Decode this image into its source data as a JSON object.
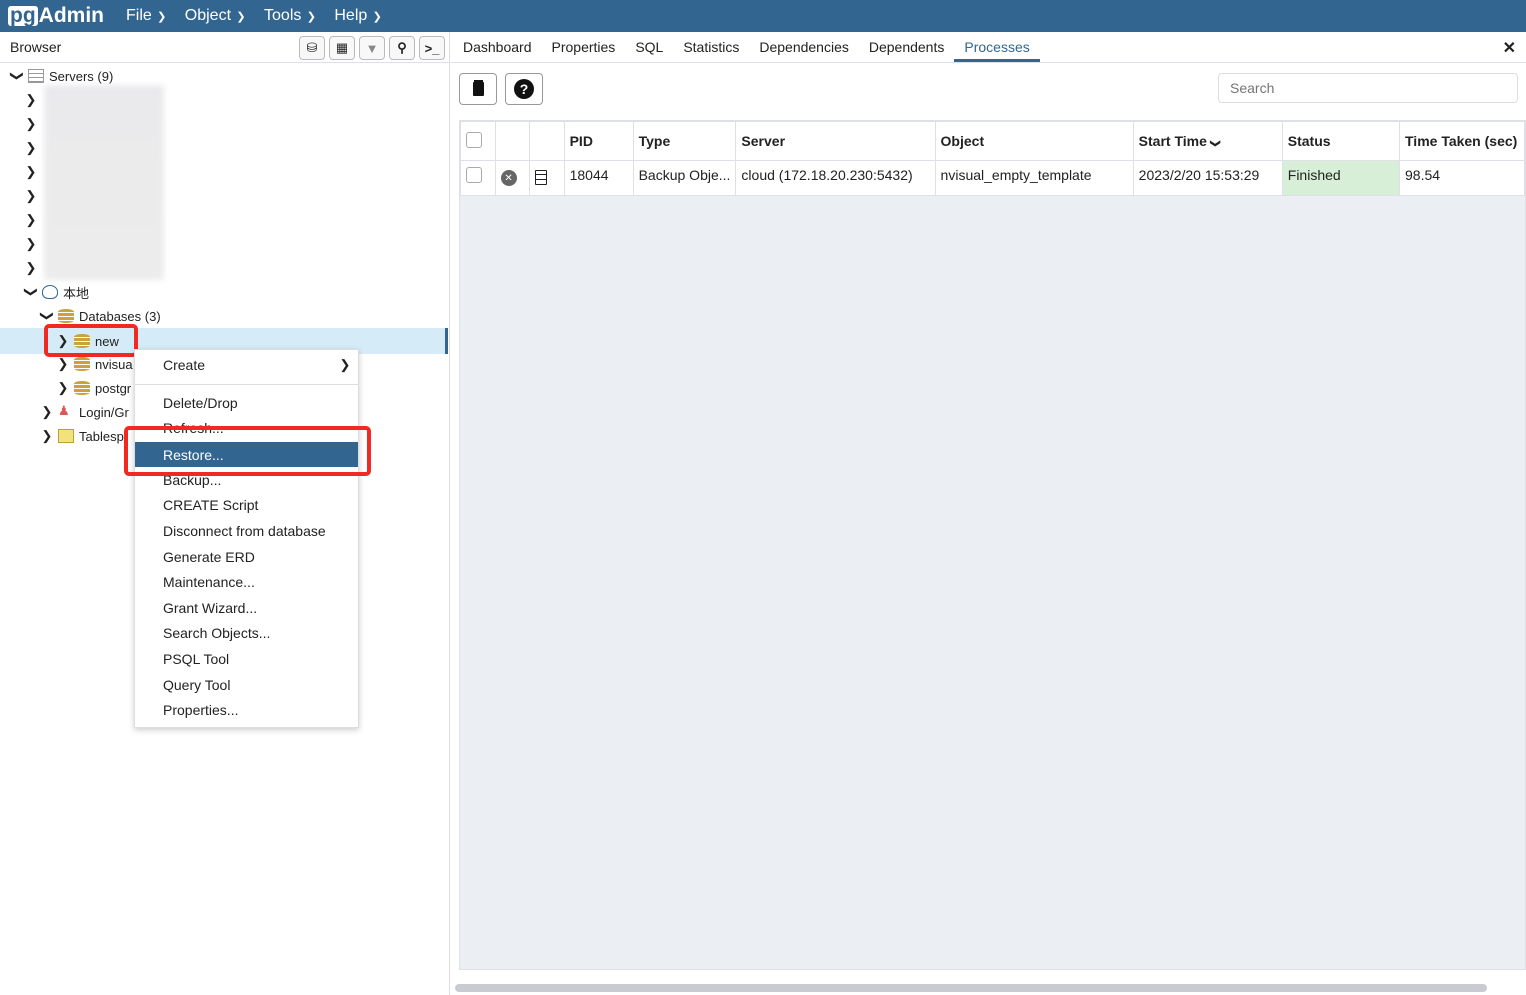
{
  "app": {
    "logo_pg": "pg",
    "logo_admin": "Admin",
    "menu": [
      "File",
      "Object",
      "Tools",
      "Help"
    ]
  },
  "browser": {
    "title": "Browser",
    "tree": {
      "servers": "Servers (9)",
      "local": "本地",
      "databases": "Databases (3)",
      "db_new": "new",
      "db_nvisual": "nvisua",
      "db_postgres": "postgr",
      "login": "Login/Gr",
      "tablespaces": "Tablesp"
    }
  },
  "context_menu": {
    "items": [
      "Create",
      "Delete/Drop",
      "Refresh...",
      "Restore...",
      "Backup...",
      "CREATE Script",
      "Disconnect from database",
      "Generate ERD",
      "Maintenance...",
      "Grant Wizard...",
      "Search Objects...",
      "PSQL Tool",
      "Query Tool",
      "Properties..."
    ],
    "active": "Restore..."
  },
  "tabs": [
    "Dashboard",
    "Properties",
    "SQL",
    "Statistics",
    "Dependencies",
    "Dependents",
    "Processes"
  ],
  "active_tab": "Processes",
  "search": {
    "placeholder": "Search"
  },
  "processes": {
    "columns": [
      "PID",
      "Type",
      "Server",
      "Object",
      "Start Time",
      "Status",
      "Time Taken (sec)"
    ],
    "rows": [
      {
        "pid": "18044",
        "type": "Backup Obje...",
        "server": "cloud (172.18.20.230:5432)",
        "object": "nvisual_empty_template",
        "start": "2023/2/20 15:53:29",
        "status": "Finished",
        "time": "98.54"
      }
    ]
  },
  "colors": {
    "brand": "#326690",
    "highlight": "#f02a22",
    "finished": "#d7efd7"
  }
}
